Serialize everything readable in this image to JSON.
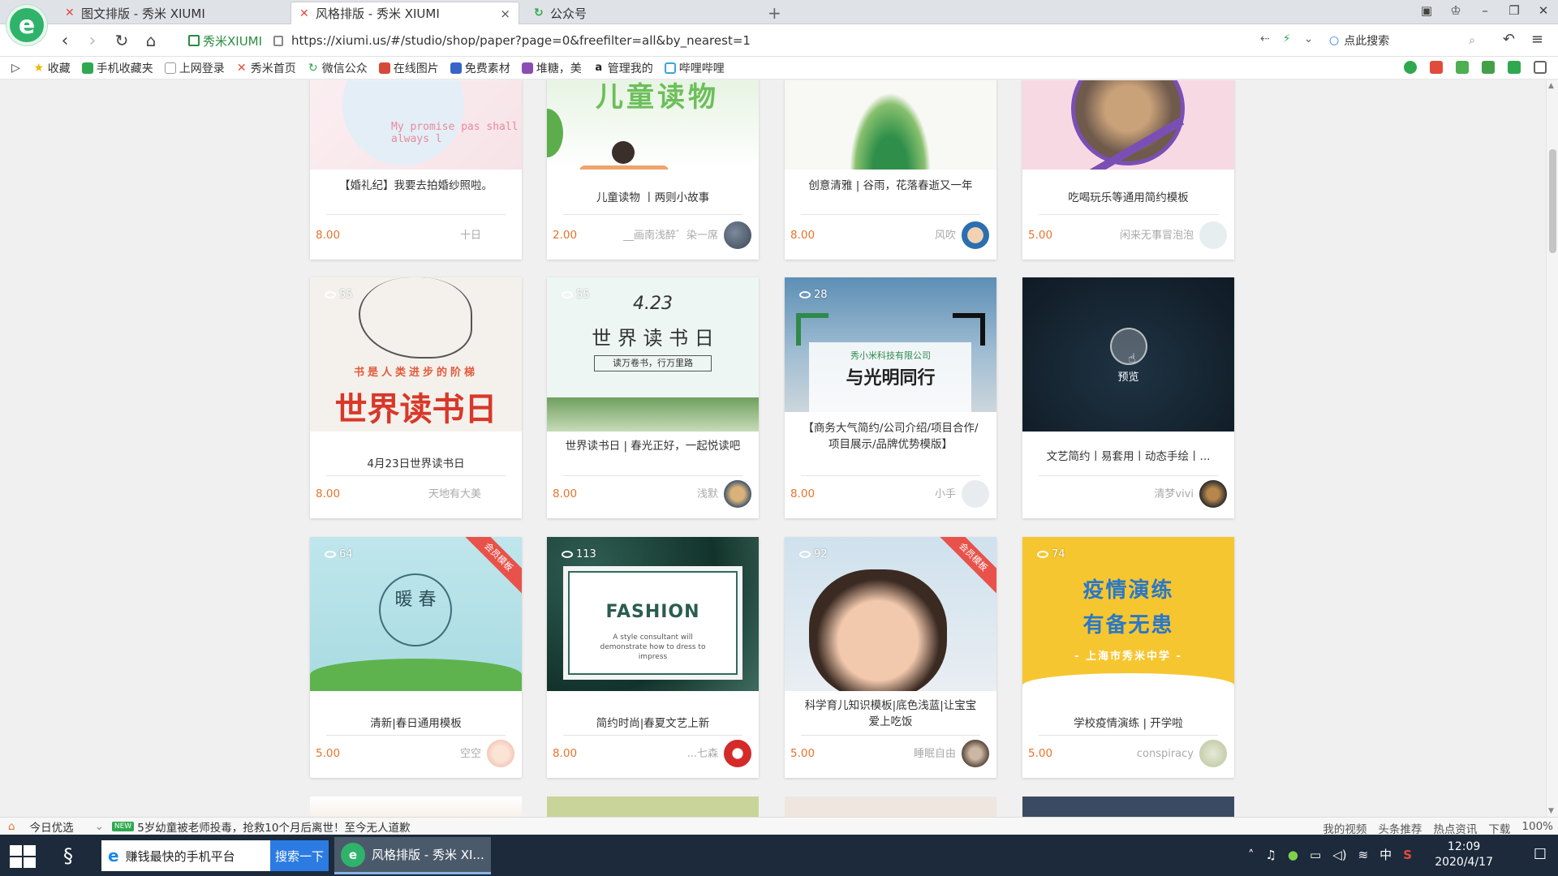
{
  "browser": {
    "tabs": [
      {
        "label": "图文排版 - 秀米 XIUMI"
      },
      {
        "label": "风格排版 - 秀米 XIUMI"
      },
      {
        "label": "公众号"
      }
    ],
    "address": {
      "site_name": "秀米XIUMI",
      "url": "https://xiumi.us/#/studio/shop/paper?page=0&freefilter=all&by_nearest=1",
      "search_label": "点此搜索"
    },
    "bookmarks": [
      "收藏",
      "手机收藏夹",
      "上网登录",
      "秀米首页",
      "微信公众",
      "在线图片",
      "免费素材",
      "堆糖，美",
      "管理我的",
      "哔哩哔哩"
    ]
  },
  "cards_partial": [
    {
      "title": "【婚礼纪】我要去拍婚纱照啦。",
      "price": "8.00",
      "author": "十日",
      "img_text": "My promise pas shall always l"
    },
    {
      "title": "儿童读物 丨两则小故事",
      "price": "2.00",
      "author": "__画南浅醉゛染一席",
      "img_text": "儿童读物"
    },
    {
      "title": "创意清雅 | 谷雨，花落春逝又一年",
      "price": "8.00",
      "author": "风吹"
    },
    {
      "title": "吃喝玩乐等通用简约模板",
      "price": "5.00",
      "author": "闲来无事冒泡泡"
    }
  ],
  "cards": [
    {
      "views": "55",
      "title": "4月23日世界读书日",
      "price": "8.00",
      "author": "天地有大美",
      "img_main": "世界读书日",
      "img_sub": "书是人类进步的阶梯"
    },
    {
      "views": "55",
      "title": "世界读书日 | 春光正好，一起悦读吧",
      "price": "8.00",
      "author": "浅默",
      "img_date": "4.23",
      "img_main": "世 界 读 书 日",
      "img_sub": "读万卷书，行万里路"
    },
    {
      "views": "28",
      "title": "【商务大气简约/公司介绍/项目合作/项目展示/品牌优势模版】",
      "price": "8.00",
      "author": "小手",
      "img_company": "秀小米科技有限公司",
      "img_main": "与光明同行"
    },
    {
      "title": "文艺简约丨易套用丨动态手绘丨...",
      "author": "清梦vivi",
      "preview_label": "预览"
    },
    {
      "views": "64",
      "title": "清新|春日通用模板",
      "price": "5.00",
      "author": "空空",
      "ribbon": "会员模板",
      "img_main": "暖 春"
    },
    {
      "views": "113",
      "title": "简约时尚|春夏文艺上新",
      "price": "8.00",
      "author": "...七森",
      "img_main": "FASHION",
      "img_sub": "A style consultant will demonstrate how to dress to impress"
    },
    {
      "views": "92",
      "title": "科学育儿知识模板|底色浅蓝|让宝宝爱上吃饭",
      "price": "5.00",
      "author": "睡眠自由",
      "ribbon": "会员模板"
    },
    {
      "views": "74",
      "title": "学校疫情演练 | 开学啦",
      "price": "5.00",
      "author": "conspiracy",
      "img_main1": "疫情演练",
      "img_main2": "有备无患",
      "img_sub": "- 上海市秀米中学 -"
    }
  ],
  "status": {
    "left1": "今日优选",
    "news_badge": "NEW",
    "news": "5岁幼童被老师投毒，抢救10个月后离世！至今无人道歉",
    "right": [
      "我的视频",
      "头条推荐",
      "热点资讯",
      "下载",
      "100%"
    ]
  },
  "taskbar": {
    "search_text": "赚钱最快的手机平台",
    "search_button": "搜索一下",
    "app_label": "风格排版 - 秀米 XI...",
    "ime": "中",
    "time": "12:09",
    "date": "2020/4/17"
  },
  "colors": {
    "price": "#e8732c",
    "ribbon": "#e8524a",
    "accent_green": "#2fb36b"
  }
}
